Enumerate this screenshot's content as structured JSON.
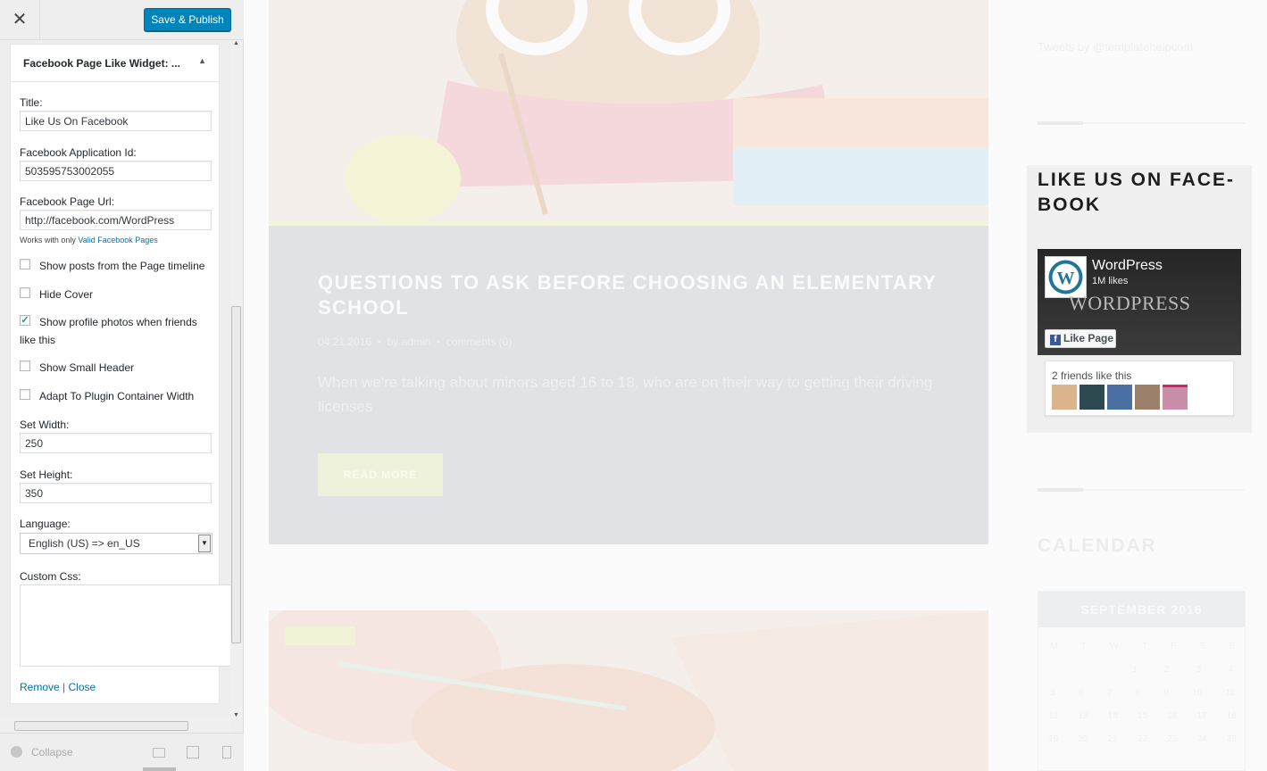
{
  "customizer": {
    "close_icon": "close-icon",
    "publish_label": "Save & Publish",
    "widget": {
      "title": "Facebook Page Like Widget: ...",
      "fields": {
        "title_label": "Title:",
        "title_value": "Like Us On Facebook",
        "app_id_label": "Facebook Application Id:",
        "app_id_value": "503595753002055",
        "page_url_label": "Facebook Page Url:",
        "page_url_value": "http://facebook.com/WordPress",
        "page_url_note": "Works with only",
        "page_url_note_link": "Valid Facebook Pages",
        "width_label": "Set Width:",
        "width_value": "250",
        "height_label": "Set Height:",
        "height_value": "350",
        "language_label": "Language:",
        "language_value": "English (US) => en_US",
        "custom_css_label": "Custom Css:"
      },
      "checkboxes": [
        {
          "label": "Show posts from the Page timeline",
          "checked": false
        },
        {
          "label": "Hide Cover",
          "checked": false
        },
        {
          "label": "Show profile photos when friends like this",
          "checked": true
        },
        {
          "label": "Show Small Header",
          "checked": false
        },
        {
          "label": "Adapt To Plugin Container Width",
          "checked": false
        }
      ],
      "remove_label": "Remove",
      "separator": "|",
      "close_label": "Close"
    },
    "collapse_label": "Collapse"
  },
  "preview": {
    "tweets_text": "Tweets by @templatehelpcom",
    "post": {
      "title": "QUESTIONS TO ASK BEFORE CHOOSING AN ELEMENTARY SCHOOL",
      "date": "04.21.2016",
      "author": "by admin",
      "comments": "comments (0)",
      "bullet": "•",
      "excerpt": "When we're talking about minors aged 16 to 18, who are on their way to getting their driving licenses",
      "read_more": "READ MORE"
    },
    "facebook_widget": {
      "heading": "LIKE US ON FACE-BOOK",
      "page_name": "WordPress",
      "likes": "1M likes",
      "wordmark": "WORDPRESS",
      "like_button": "Like Page",
      "friends_text": "2 friends like this"
    },
    "calendar": {
      "heading": "CALENDAR",
      "month": "SEPTEMBER 2016",
      "weekdays": [
        "M",
        "T",
        "W",
        "T",
        "F",
        "S",
        "S"
      ],
      "rows": [
        [
          "",
          "",
          "",
          "1",
          "2",
          "3",
          "4"
        ],
        [
          "5",
          "6",
          "7",
          "8",
          "9",
          "10",
          "11"
        ],
        [
          "12",
          "13",
          "14",
          "15",
          "16",
          "17",
          "18"
        ],
        [
          "19",
          "20",
          "21",
          "22",
          "23",
          "24",
          "25"
        ]
      ]
    }
  },
  "colors": {
    "publish_blue": "#0085ba",
    "link_blue": "#0073aa",
    "facebook_blue": "#3b5998"
  }
}
